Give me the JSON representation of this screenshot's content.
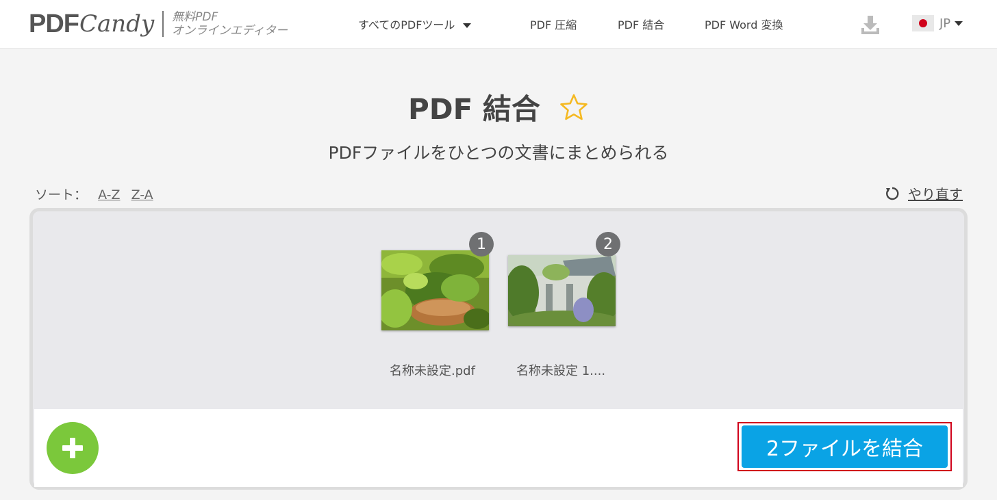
{
  "header": {
    "logo_main": "PDF",
    "logo_script": "Candy",
    "tagline_line1": "無料PDF",
    "tagline_line2": "オンラインエディター",
    "nav": {
      "all_tools": "すべてのPDFツール",
      "compress": "PDF 圧縮",
      "merge": "PDF 結合",
      "word": "PDF Word 変換"
    },
    "lang": "JP"
  },
  "page": {
    "title": "PDF 結合",
    "subtitle": "PDFファイルをひとつの文書にまとめられる"
  },
  "sort": {
    "label": "ソート：",
    "az": "A-Z",
    "za": "Z-A",
    "redo": "やり直す"
  },
  "files": [
    {
      "index": "1",
      "name": "名称未設定.pdf"
    },
    {
      "index": "2",
      "name": "名称未設定 1...."
    }
  ],
  "actions": {
    "merge_button": "2ファイルを結合"
  },
  "colors": {
    "accent": "#0aa3e5",
    "add": "#7bc83b",
    "star": "#f5b921",
    "highlight": "#d0021b"
  }
}
